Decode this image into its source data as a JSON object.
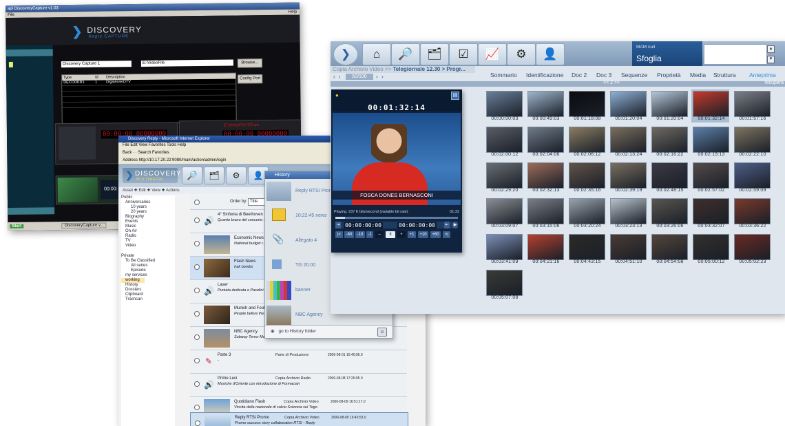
{
  "capture_window": {
    "title": "api DiscoveryCapture  v1.03",
    "menu": "File",
    "help": "Help",
    "logo": "DISCOVERY",
    "logo_sub": "Reply CAPTURE",
    "session_name": "Discovery Capture 1",
    "path": "E:\\VideoFile",
    "browse_label": "Browse...",
    "config_label": "Config Port",
    "table_headers": [
      "Type",
      "Id",
      "Description"
    ],
    "table_rows": [
      [
        "DECODER1",
        "1",
        "DigiserverDTV"
      ]
    ],
    "timer_a": "00:00:00  00000000",
    "timer_b": "00:00:00  00000000",
    "file_label": "E:\\VideoFile\\TO.avi",
    "mini_timer": "00:00:",
    "start_label": "Start",
    "taskbar_item": "DiscoveryCapture v..."
  },
  "reply_window": {
    "title": "Discovery Reply - Microsoft Internet Explorer",
    "menu": "File   Edit   View   Favorites   Tools   Help",
    "toolbar": "Back  ·  ·  Search   Favorites",
    "address": "Address   http://10.17.20.22:9080/mam/action/admin/login",
    "logo": "DISCOVERY",
    "logo_sub": "MULTIMEDIA",
    "actions": "Asset   ✚ Edit   ✚ View   ✚ Actions",
    "order_label": "Order by:",
    "order_value": "Title",
    "tree": [
      "Public",
      "Anniversaries",
      "10 years",
      "20 years",
      "Biography",
      "Events",
      "Music",
      "On Air",
      "Radio",
      "TV",
      "Video",
      "Private",
      "To Be Classified",
      "All series",
      "Episode",
      "my services",
      "working",
      "History",
      "Dossiers",
      "Clipboard",
      "Trashcan"
    ],
    "assets": [
      {
        "title": "4° Sinfonia di Beethoven",
        "desc": "Quanto brano del concerto ..."
      },
      {
        "title": "Economic News",
        "desc": "National budget r..."
      },
      {
        "title": "Flash News",
        "desc": "Irak bombs"
      },
      {
        "title": "Laser",
        "desc": "Puntata dedicata a Pasolini"
      },
      {
        "title": "Munich and Foot...",
        "desc": "People before the..."
      },
      {
        "title": "NBC Agency",
        "desc": "Subway Terror Model"
      },
      {
        "title": "Parte 3",
        "desc": "-",
        "type": "Parte di Produzione",
        "date": "2006-08-01 16:40:06.0"
      },
      {
        "title": "Prime Luci",
        "desc": "Musiche d'Oriente con introduzione di Formaciari",
        "type": "Copia Archivio Radio",
        "date": "2006-08-08 17:26:05.0"
      },
      {
        "title": "Quotidiano Flash",
        "desc": "Vincita della nazionale di calcio Svizzera sul Togo",
        "type": "Copia Archivio Video",
        "date": "2006-08-09 16:51:17.0"
      },
      {
        "title": "Reply RTSI Promo",
        "desc": "Promo success story collaboration RTSI - Reply",
        "type": "Copia Archivio Video",
        "date": "2006-08-09 16:43:53.0"
      }
    ]
  },
  "history_popup": {
    "title": "History",
    "items": [
      "Reply RTSI Promo",
      "10:22:45  news",
      "Allegato 4",
      "TG 20.00",
      "banner",
      "NBC Agency"
    ],
    "footer": "go to History folder"
  },
  "mam_window": {
    "mam_label": "MAM null",
    "mode": "Sfoglia",
    "breadcrumb_prefix": "Copia Archivio Video >>",
    "breadcrumb_current": "Telegiornale 12.30 > Progr...",
    "pager_value": "50/100",
    "tabs": [
      "Sommario",
      "Identificazione",
      "Doc 2",
      "Doc 3",
      "Sequenze",
      "Proprietà",
      "Media",
      "Struttura",
      "Anteprima"
    ],
    "strip_pager": "<<  2   >>",
    "strip_right": "recupera",
    "player_time": "00:01:32:14",
    "player_caption": "FOSCA DONES BERNASCONI",
    "player_status": "Playing: 237 K bits/second (variable bit rate)",
    "player_status_time": "01:32",
    "tc_in": "00:00:00:00",
    "tc_out": "00:00:00:00",
    "transport": [
      "|<",
      "-60",
      "-10",
      "-1",
      "II",
      "+1",
      "+10",
      "+60",
      ">|"
    ],
    "thumbnails": [
      "00:00:00:03",
      "00:00:49:03",
      "00:01:18:08",
      "00:01:20:04",
      "00:01:20:04",
      "00:01:32:14",
      "00:01:57:16",
      "00:02:00:12",
      "00:02:04:06",
      "00:02:06:12",
      "00:02:13:24",
      "00:02:16:22",
      "00:02:19:13",
      "00:02:22:10",
      "00:02:29:20",
      "00:02:32:13",
      "00:02:35:16",
      "00:02:39:19",
      "00:02:48:15",
      "00:02:57:02",
      "00:02:59:09",
      "00:03:09:07",
      "00:03:15:06",
      "00:03:20:24",
      "00:03:23:13",
      "00:03:26:06",
      "00:03:32:07",
      "00:03:36:22",
      "00:03:41:09",
      "00:04:21:16",
      "00:04:43:15",
      "00:04:51:10",
      "00:04:54:08",
      "00:05:00:12",
      "00:05:02:23",
      "00:05:07:08"
    ],
    "thumb_colors": [
      "#6a7f9a",
      "#9fb6cc",
      "#0b0b0f",
      "#8fb0d6",
      "#b7c7d8",
      "#c43a2a",
      "#7d7f86",
      "#5a5e66",
      "#6f7a88",
      "#8a7c63",
      "#7a6e5e",
      "#6e6a62",
      "#5c7fa8",
      "#7e7460",
      "#6a6e74",
      "#9d6b5a",
      "#615449",
      "#7b6f60",
      "#3c3b44",
      "#554b4a",
      "#4e5f86",
      "#8b8e93",
      "#7a7f86",
      "#9aa3ad",
      "#b9c2ca",
      "#5a564f",
      "#3f2f2b",
      "#7b3a2a",
      "#7c8fb6",
      "#b5402f",
      "#2d2a27",
      "#4a3b32",
      "#55463a",
      "#34302c",
      "#6a2a22",
      "#3a3b35"
    ]
  }
}
